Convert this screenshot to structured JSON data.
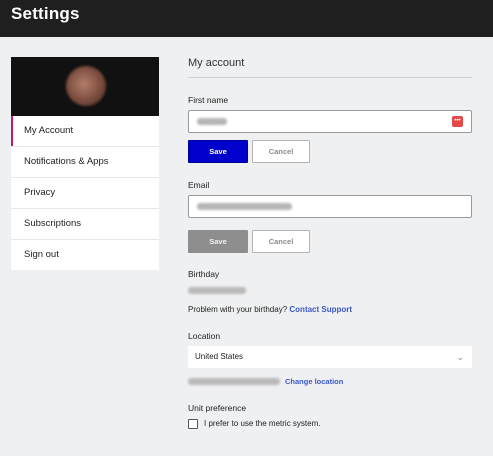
{
  "header": {
    "title": "Settings"
  },
  "sidebar": {
    "items": [
      {
        "label": "My Account"
      },
      {
        "label": "Notifications & Apps"
      },
      {
        "label": "Privacy"
      },
      {
        "label": "Subscriptions"
      },
      {
        "label": "Sign out"
      }
    ],
    "active_index": 0
  },
  "main": {
    "section_title": "My account",
    "first_name": {
      "label": "First name",
      "save_label": "Save",
      "cancel_label": "Cancel"
    },
    "email": {
      "label": "Email",
      "save_label": "Save",
      "cancel_label": "Cancel"
    },
    "birthday": {
      "label": "Birthday",
      "problem_text": "Problem with your birthday?",
      "contact_link": "Contact Support"
    },
    "location": {
      "label": "Location",
      "selected": "United States",
      "change_link": "Change location"
    },
    "unit_preference": {
      "label": "Unit preference",
      "checkbox_label": "I prefer to use the metric system.",
      "checked": false
    }
  },
  "colors": {
    "topbar": "#1f1f1f",
    "accent_active": "#c8146e",
    "primary_button": "#0000cc",
    "link": "#3b59c9"
  }
}
